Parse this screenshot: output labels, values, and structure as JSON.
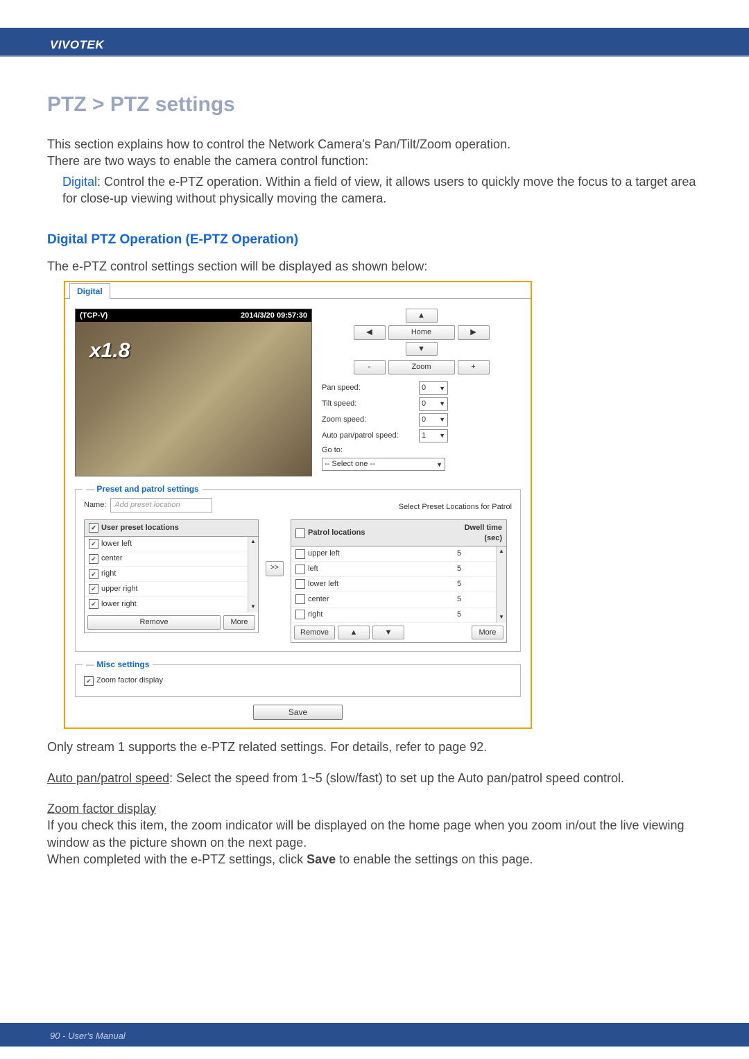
{
  "header": {
    "brand": "VIVOTEK"
  },
  "title": "PTZ > PTZ settings",
  "intro1": "This section explains how to control the Network Camera's Pan/Tilt/Zoom operation.",
  "intro2": "There are two ways to enable the camera control function:",
  "digital_label": "Digital",
  "digital_desc": ": Control the e-PTZ operation. Within a field of view, it allows users to quickly move the focus to a target area for close-up viewing without physically moving the camera.",
  "subhead": "Digital PTZ Operation (E-PTZ Operation)",
  "subtext": "The e-PTZ control settings section will be displayed as shown below:",
  "ui": {
    "tab": "Digital",
    "preview": {
      "name": "(TCP-V)",
      "timestamp": "2014/3/20 09:57:30",
      "zoom_indicator": "x1.8"
    },
    "dpad": {
      "up": "▲",
      "down": "▼",
      "left": "◀",
      "right": "▶",
      "home": "Home",
      "zoom_label": "Zoom",
      "zoom_out": "-",
      "zoom_in": "+"
    },
    "speeds": {
      "pan_label": "Pan speed:",
      "tilt_label": "Tilt speed:",
      "zoom_label": "Zoom speed:",
      "auto_label": "Auto pan/patrol speed:",
      "pan": "0",
      "tilt": "0",
      "zoom": "0",
      "auto": "1",
      "goto_label": "Go to:",
      "goto": "-- Select one --"
    },
    "preset": {
      "legend": "Preset and patrol settings",
      "name_label": "Name:",
      "name_placeholder": "Add preset location",
      "select_label": "Select Preset Locations for Patrol",
      "user_header": "User preset locations",
      "user_items": [
        "lower left",
        "center",
        "right",
        "upper right",
        "lower right"
      ],
      "user_checked": [
        true,
        true,
        true,
        true,
        true
      ],
      "patrol_header": "Patrol locations",
      "dwell_header": "Dwell time (sec)",
      "patrol_items": [
        "upper left",
        "left",
        "lower left",
        "center",
        "right"
      ],
      "patrol_dwell": [
        "5",
        "5",
        "5",
        "5",
        "5"
      ],
      "remove": "Remove",
      "more": "More",
      "move_btn": ">>",
      "up_btn": "▲",
      "down_btn": "▼"
    },
    "misc": {
      "legend": "Misc settings",
      "zoom_factor": "Zoom factor display",
      "zoom_factor_checked": true
    },
    "save": "Save"
  },
  "after1": "Only stream 1 supports the e-PTZ related settings. For details, refer to page 92.",
  "after2_label": "Auto pan/patrol speed",
  "after2_text": ": Select the speed from 1~5 (slow/fast) to set up the Auto pan/patrol speed control.",
  "after3_label": "Zoom factor display",
  "after3a": "If you check this item, the zoom indicator will be displayed on the home page when you zoom in/out the live viewing window as the picture shown on the next page.",
  "after3b_pre": "When completed with the e-PTZ settings, click ",
  "after3b_bold": "Save",
  "after3b_post": " to enable the settings on this page.",
  "footer": {
    "page": "90 - User's Manual"
  }
}
